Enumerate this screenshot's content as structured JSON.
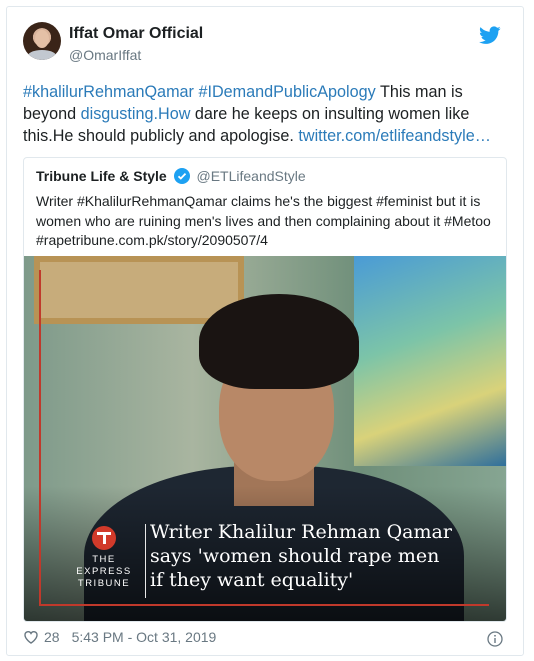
{
  "author": {
    "name": "Iffat Omar Official",
    "handle": "@OmarIffat"
  },
  "tweet": {
    "link1": "#khalilurRehmanQamar",
    "link2": "#IDemandPublicApology",
    "text1": " This man is beyond ",
    "link3": "disgusting.How",
    "text2": " dare he keeps on insulting women like this.He should publicly and apologise. ",
    "link4": "twitter.com/etlifeandstyle…"
  },
  "quoted": {
    "name": "Tribune Life & Style",
    "handle": "@ETLifeandStyle",
    "text": "Writer #KhalilurRehmanQamar claims he's the biggest #feminist but it is women who are ruining men's lives and then complaining about it #Metoo #rapetribune.com.pk/story/2090507/4"
  },
  "media": {
    "brand": "THE\nEXPRESS\nTRIBUNE",
    "headline": "Writer Khalilur Rehman Qamar\nsays 'women should rape men\nif they want equality'"
  },
  "footer": {
    "likes": "28",
    "timestamp": "5:43 PM - Oct 31, 2019"
  },
  "icons": {
    "heart": "heart-icon",
    "info": "info-icon",
    "bird": "twitter-bird-icon",
    "verified": "verified-badge-icon"
  },
  "colors": {
    "link": "#2b7bb9",
    "muted": "#697882",
    "twitter_blue": "#1da1f2"
  }
}
